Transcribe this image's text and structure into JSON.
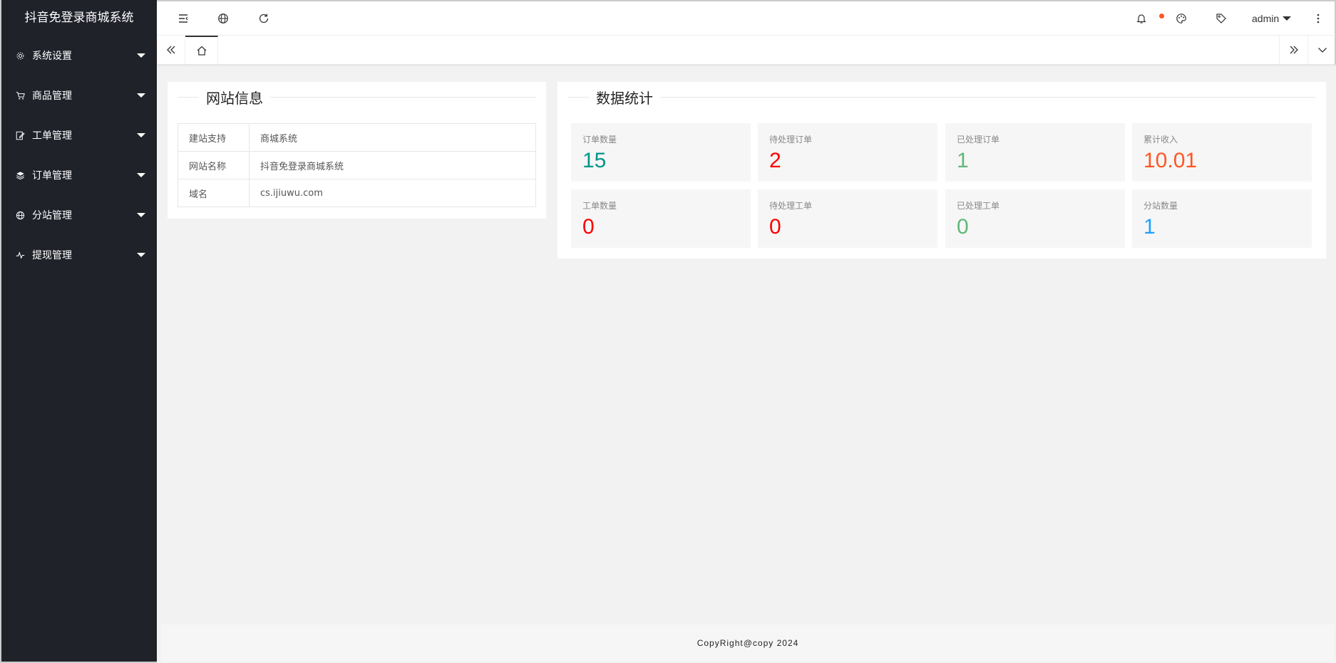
{
  "app": {
    "title": "抖音免登录商城系统"
  },
  "sidebar": {
    "items": [
      {
        "label": "系统设置",
        "icon": "gear-icon"
      },
      {
        "label": "商品管理",
        "icon": "cart-icon"
      },
      {
        "label": "工单管理",
        "icon": "edit-icon"
      },
      {
        "label": "订单管理",
        "icon": "layers-icon"
      },
      {
        "label": "分站管理",
        "icon": "globe-icon"
      },
      {
        "label": "提现管理",
        "icon": "pulse-icon"
      }
    ]
  },
  "header": {
    "user": "admin",
    "notification_dot_color": "#ff5722"
  },
  "site_info": {
    "title": "网站信息",
    "rows": [
      {
        "key": "建站支持",
        "value": "商城系统"
      },
      {
        "key": "网站名称",
        "value": "抖音免登录商城系统"
      },
      {
        "key": "域名",
        "value": "cs.ijiuwu.com"
      }
    ]
  },
  "stats": {
    "title": "数据统计",
    "items": [
      {
        "label": "订单数量",
        "value": "15",
        "color": "#009688"
      },
      {
        "label": "待处理订单",
        "value": "2",
        "color": "#ff0000"
      },
      {
        "label": "已处理订单",
        "value": "1",
        "color": "#5fb878"
      },
      {
        "label": "累计收入",
        "value": "10.01",
        "color": "#ff5722"
      },
      {
        "label": "工单数量",
        "value": "0",
        "color": "#ff0000"
      },
      {
        "label": "待处理工单",
        "value": "0",
        "color": "#ff0000"
      },
      {
        "label": "已处理工单",
        "value": "0",
        "color": "#5fb878"
      },
      {
        "label": "分站数量",
        "value": "1",
        "color": "#1e9fff"
      }
    ]
  },
  "footer": {
    "text": "CopyRight@copy 2024"
  }
}
